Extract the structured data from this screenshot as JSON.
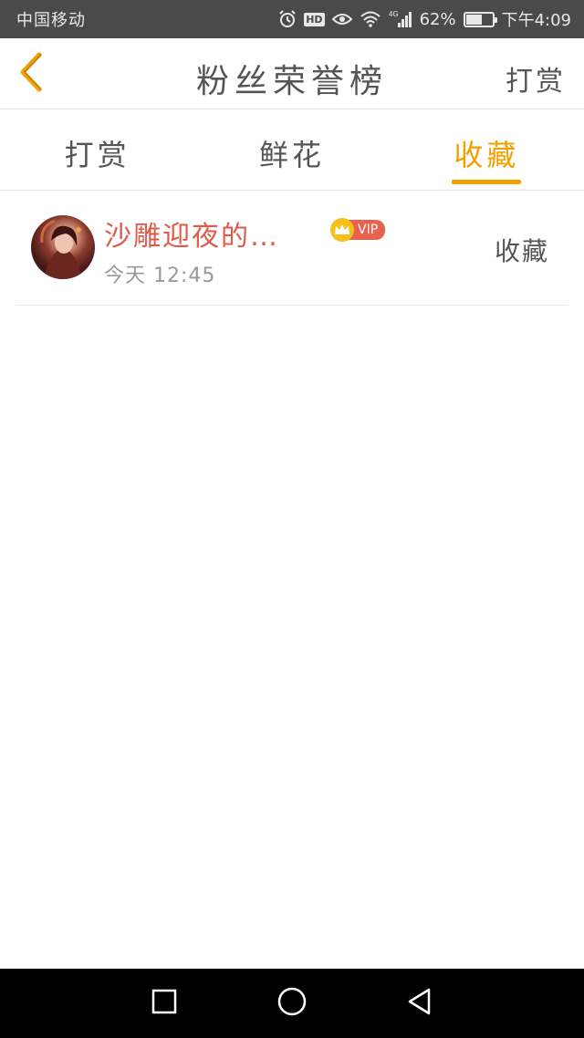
{
  "status_bar": {
    "carrier": "中国移动",
    "battery_text": "62%",
    "battery_level": 0.62,
    "time": "下午4:09",
    "network": "4G"
  },
  "header": {
    "title": "粉丝荣誉榜",
    "action": "打赏"
  },
  "tabs": [
    {
      "label": "打赏",
      "active": false
    },
    {
      "label": "鲜花",
      "active": false
    },
    {
      "label": "收藏",
      "active": true
    }
  ],
  "list": [
    {
      "username": "沙雕迎夜的…",
      "badge": "VIP",
      "time": "今天 12:45",
      "action": "收藏"
    }
  ],
  "colors": {
    "accent": "#f2a000",
    "username": "#e05a4a",
    "vip_badge": "#e8624f",
    "crown": "#f6c21a"
  },
  "icons": {
    "back": "chevron-left-icon",
    "recent": "square-icon",
    "home": "circle-icon",
    "back_nav": "triangle-left-icon"
  }
}
